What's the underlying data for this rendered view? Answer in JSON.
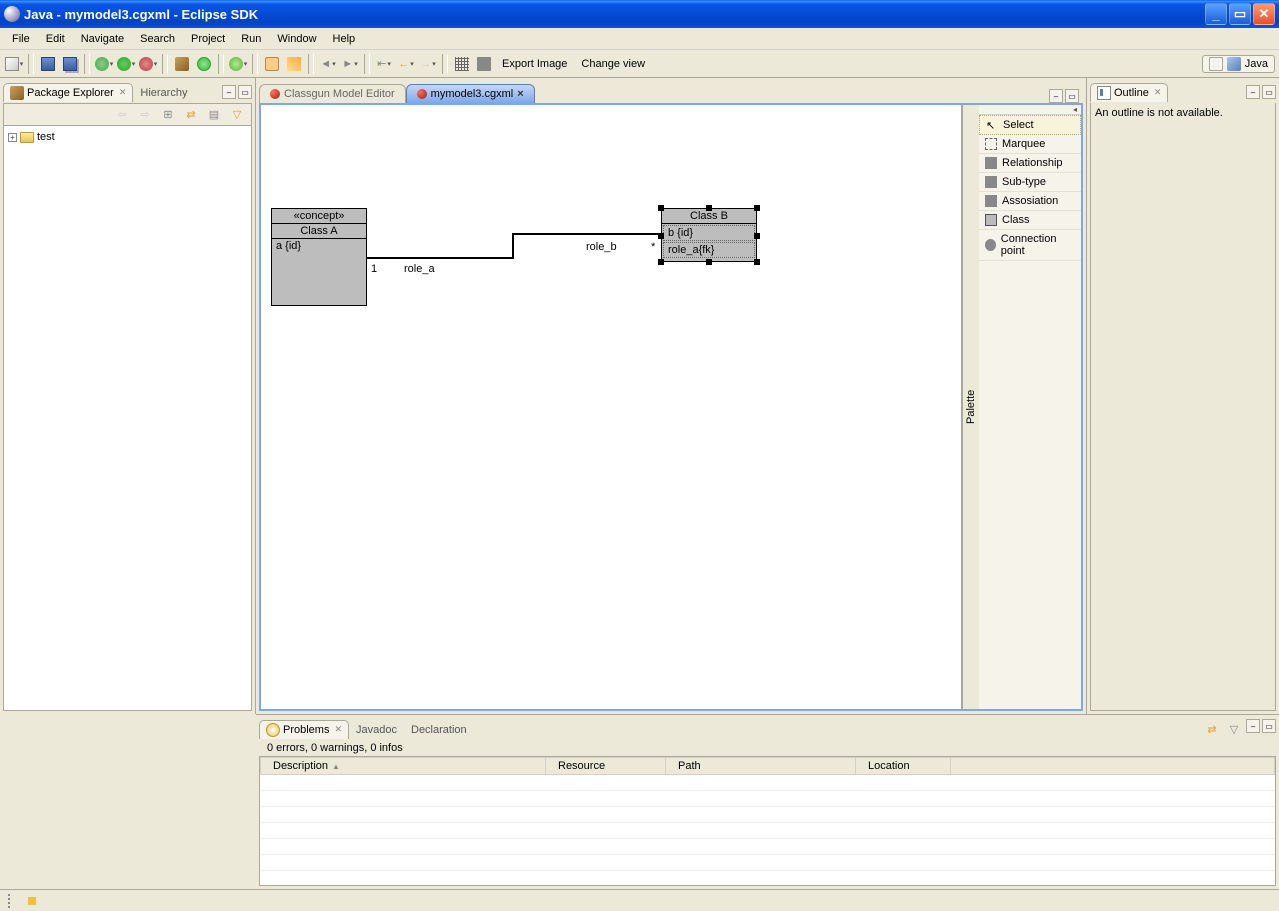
{
  "window": {
    "title": "Java - mymodel3.cgxml - Eclipse SDK"
  },
  "menu": {
    "items": [
      "File",
      "Edit",
      "Navigate",
      "Search",
      "Project",
      "Run",
      "Window",
      "Help"
    ]
  },
  "toolbar": {
    "export_image": "Export Image",
    "change_view": "Change view"
  },
  "perspective": {
    "label": "Java"
  },
  "package_explorer": {
    "title": "Package Explorer",
    "other_tab": "Hierarchy",
    "items": [
      {
        "label": "test"
      }
    ]
  },
  "editor": {
    "tabs": [
      {
        "label": "Classgun Model Editor",
        "active": false
      },
      {
        "label": "mymodel3.cgxml",
        "active": true
      }
    ]
  },
  "diagram": {
    "classA": {
      "stereotype": "«concept»",
      "name": "Class A",
      "attr": "a {id}"
    },
    "classB": {
      "name": "Class B",
      "attr1": "b {id}",
      "attr2": "role_a{fk}"
    },
    "role_a": "role_a",
    "role_b": "role_b",
    "mult_left": "1",
    "mult_right": "*"
  },
  "palette": {
    "title": "Palette",
    "items": [
      "Select",
      "Marquee",
      "Relationship",
      "Sub-type",
      "Assosiation",
      "Class",
      "Connection point"
    ]
  },
  "outline": {
    "title": "Outline",
    "message": "An outline is not available."
  },
  "problems": {
    "tabs": [
      "Problems",
      "Javadoc",
      "Declaration"
    ],
    "summary": "0 errors, 0 warnings, 0 infos",
    "columns": [
      "Description",
      "Resource",
      "Path",
      "Location"
    ]
  }
}
